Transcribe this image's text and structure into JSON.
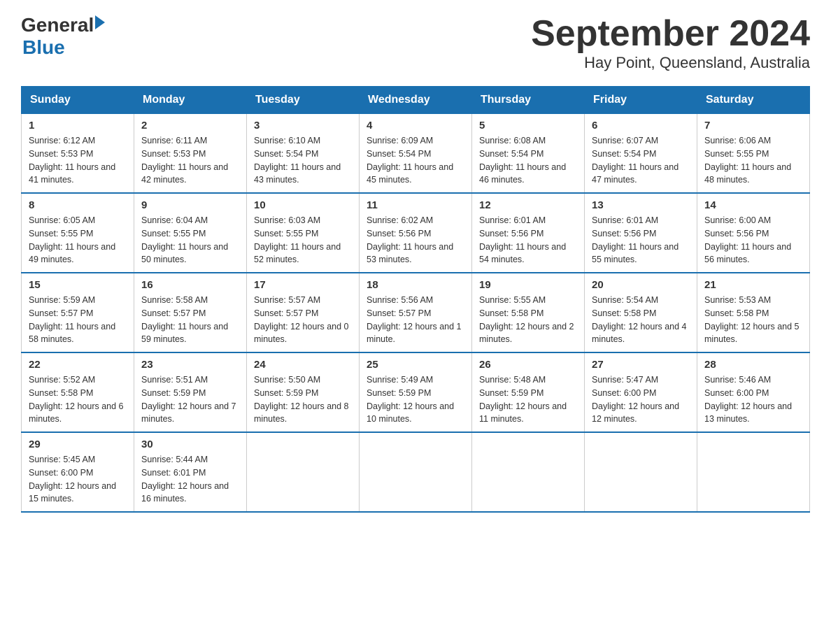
{
  "header": {
    "logo_general": "General",
    "logo_arrow": "▶",
    "logo_blue": "Blue",
    "title": "September 2024",
    "subtitle": "Hay Point, Queensland, Australia"
  },
  "days_of_week": [
    "Sunday",
    "Monday",
    "Tuesday",
    "Wednesday",
    "Thursday",
    "Friday",
    "Saturday"
  ],
  "weeks": [
    [
      {
        "day": "1",
        "sunrise": "6:12 AM",
        "sunset": "5:53 PM",
        "daylight": "11 hours and 41 minutes."
      },
      {
        "day": "2",
        "sunrise": "6:11 AM",
        "sunset": "5:53 PM",
        "daylight": "11 hours and 42 minutes."
      },
      {
        "day": "3",
        "sunrise": "6:10 AM",
        "sunset": "5:54 PM",
        "daylight": "11 hours and 43 minutes."
      },
      {
        "day": "4",
        "sunrise": "6:09 AM",
        "sunset": "5:54 PM",
        "daylight": "11 hours and 45 minutes."
      },
      {
        "day": "5",
        "sunrise": "6:08 AM",
        "sunset": "5:54 PM",
        "daylight": "11 hours and 46 minutes."
      },
      {
        "day": "6",
        "sunrise": "6:07 AM",
        "sunset": "5:54 PM",
        "daylight": "11 hours and 47 minutes."
      },
      {
        "day": "7",
        "sunrise": "6:06 AM",
        "sunset": "5:55 PM",
        "daylight": "11 hours and 48 minutes."
      }
    ],
    [
      {
        "day": "8",
        "sunrise": "6:05 AM",
        "sunset": "5:55 PM",
        "daylight": "11 hours and 49 minutes."
      },
      {
        "day": "9",
        "sunrise": "6:04 AM",
        "sunset": "5:55 PM",
        "daylight": "11 hours and 50 minutes."
      },
      {
        "day": "10",
        "sunrise": "6:03 AM",
        "sunset": "5:55 PM",
        "daylight": "11 hours and 52 minutes."
      },
      {
        "day": "11",
        "sunrise": "6:02 AM",
        "sunset": "5:56 PM",
        "daylight": "11 hours and 53 minutes."
      },
      {
        "day": "12",
        "sunrise": "6:01 AM",
        "sunset": "5:56 PM",
        "daylight": "11 hours and 54 minutes."
      },
      {
        "day": "13",
        "sunrise": "6:01 AM",
        "sunset": "5:56 PM",
        "daylight": "11 hours and 55 minutes."
      },
      {
        "day": "14",
        "sunrise": "6:00 AM",
        "sunset": "5:56 PM",
        "daylight": "11 hours and 56 minutes."
      }
    ],
    [
      {
        "day": "15",
        "sunrise": "5:59 AM",
        "sunset": "5:57 PM",
        "daylight": "11 hours and 58 minutes."
      },
      {
        "day": "16",
        "sunrise": "5:58 AM",
        "sunset": "5:57 PM",
        "daylight": "11 hours and 59 minutes."
      },
      {
        "day": "17",
        "sunrise": "5:57 AM",
        "sunset": "5:57 PM",
        "daylight": "12 hours and 0 minutes."
      },
      {
        "day": "18",
        "sunrise": "5:56 AM",
        "sunset": "5:57 PM",
        "daylight": "12 hours and 1 minute."
      },
      {
        "day": "19",
        "sunrise": "5:55 AM",
        "sunset": "5:58 PM",
        "daylight": "12 hours and 2 minutes."
      },
      {
        "day": "20",
        "sunrise": "5:54 AM",
        "sunset": "5:58 PM",
        "daylight": "12 hours and 4 minutes."
      },
      {
        "day": "21",
        "sunrise": "5:53 AM",
        "sunset": "5:58 PM",
        "daylight": "12 hours and 5 minutes."
      }
    ],
    [
      {
        "day": "22",
        "sunrise": "5:52 AM",
        "sunset": "5:58 PM",
        "daylight": "12 hours and 6 minutes."
      },
      {
        "day": "23",
        "sunrise": "5:51 AM",
        "sunset": "5:59 PM",
        "daylight": "12 hours and 7 minutes."
      },
      {
        "day": "24",
        "sunrise": "5:50 AM",
        "sunset": "5:59 PM",
        "daylight": "12 hours and 8 minutes."
      },
      {
        "day": "25",
        "sunrise": "5:49 AM",
        "sunset": "5:59 PM",
        "daylight": "12 hours and 10 minutes."
      },
      {
        "day": "26",
        "sunrise": "5:48 AM",
        "sunset": "5:59 PM",
        "daylight": "12 hours and 11 minutes."
      },
      {
        "day": "27",
        "sunrise": "5:47 AM",
        "sunset": "6:00 PM",
        "daylight": "12 hours and 12 minutes."
      },
      {
        "day": "28",
        "sunrise": "5:46 AM",
        "sunset": "6:00 PM",
        "daylight": "12 hours and 13 minutes."
      }
    ],
    [
      {
        "day": "29",
        "sunrise": "5:45 AM",
        "sunset": "6:00 PM",
        "daylight": "12 hours and 15 minutes."
      },
      {
        "day": "30",
        "sunrise": "5:44 AM",
        "sunset": "6:01 PM",
        "daylight": "12 hours and 16 minutes."
      },
      null,
      null,
      null,
      null,
      null
    ]
  ],
  "labels": {
    "sunrise": "Sunrise:",
    "sunset": "Sunset:",
    "daylight": "Daylight:"
  }
}
